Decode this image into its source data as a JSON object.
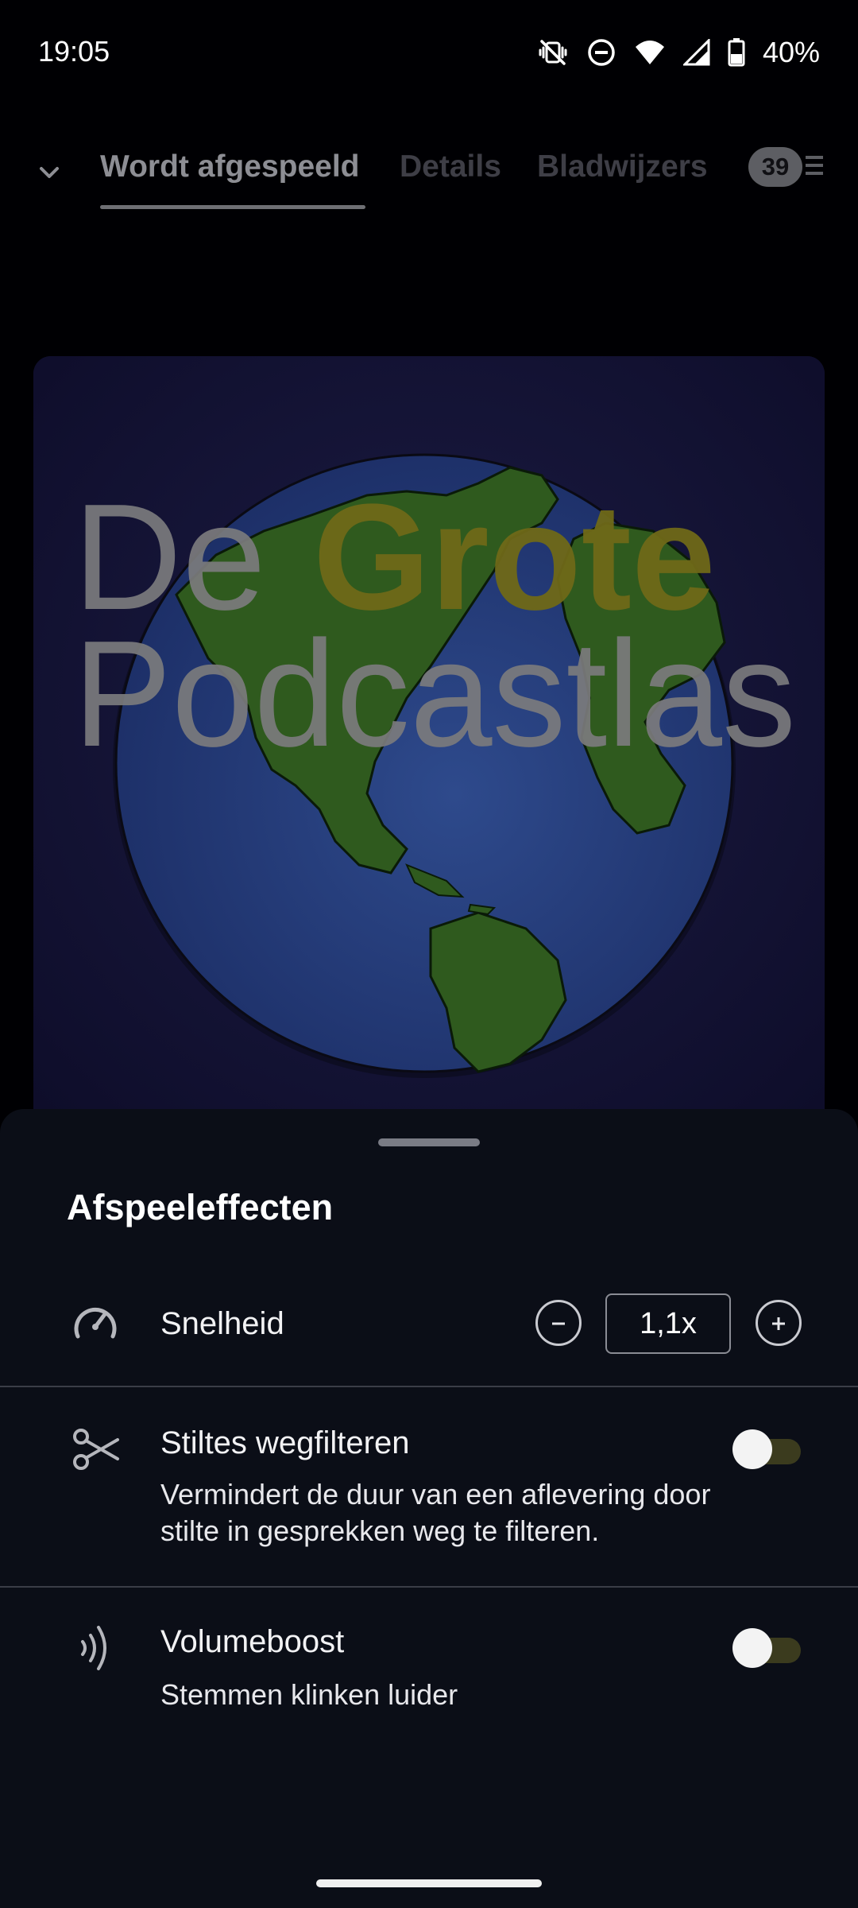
{
  "status_bar": {
    "time": "19:05",
    "battery_percent": "40%",
    "icons": [
      "vibrate-off-icon",
      "do-not-disturb-icon",
      "wifi-icon",
      "cellular-signal-icon",
      "battery-icon"
    ]
  },
  "tabs": [
    {
      "label": "Wordt afgespeeld",
      "active": true
    },
    {
      "label": "Details",
      "active": false
    },
    {
      "label": "Bladwijzers",
      "active": false
    }
  ],
  "queue": {
    "count": "39",
    "icon": "queue-list-icon"
  },
  "artwork": {
    "line1_word1": "De",
    "line1_word2": "Grote",
    "line2": "Podcastlas",
    "colors": {
      "background": "#131233",
      "ocean": "#243a78",
      "land": "#2f5a1e",
      "grote": "#6f6918",
      "text": "#7b7b7d"
    }
  },
  "sheet": {
    "title": "Afspeeleffecten",
    "speed": {
      "label": "Snelheid",
      "value": "1,1x",
      "icon": "speedometer-icon",
      "decrease_icon": "minus-icon",
      "increase_icon": "plus-icon"
    },
    "trim_silence": {
      "label": "Stiltes wegfilteren",
      "description": "Vermindert de duur van een aflevering door stilte in gesprekken weg te filteren.",
      "enabled": false,
      "icon": "scissors-icon"
    },
    "volume_boost": {
      "label": "Volumeboost",
      "description": "Stemmen klinken luider",
      "enabled": false,
      "icon": "sound-waves-icon"
    }
  },
  "colors": {
    "accent_track": "#3b3b1e",
    "sheet_bg": "#0b0e17",
    "screen_bg": "#000003"
  }
}
